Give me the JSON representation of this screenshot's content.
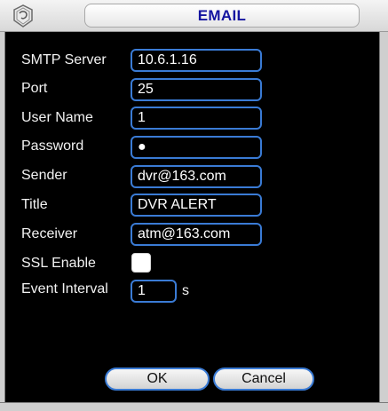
{
  "window": {
    "title": "EMAIL"
  },
  "form": {
    "smtp_server": {
      "label": "SMTP Server",
      "value": "10.6.1.16"
    },
    "port": {
      "label": "Port",
      "value": "25"
    },
    "user_name": {
      "label": "User Name",
      "value": "1"
    },
    "password": {
      "label": "Password",
      "value": "●"
    },
    "sender": {
      "label": "Sender",
      "value": "dvr@163.com"
    },
    "title": {
      "label": "Title",
      "value": "DVR ALERT"
    },
    "receiver": {
      "label": "Receiver",
      "value": "atm@163.com"
    },
    "ssl_enable": {
      "label": "SSL Enable",
      "checked": false
    },
    "event_interval": {
      "label": "Event Interval",
      "value": "1",
      "unit": "s"
    }
  },
  "buttons": {
    "ok": "OK",
    "cancel": "Cancel"
  },
  "colors": {
    "field_border": "#3a7bd5",
    "title_text": "#1414a0",
    "background": "#000000"
  }
}
